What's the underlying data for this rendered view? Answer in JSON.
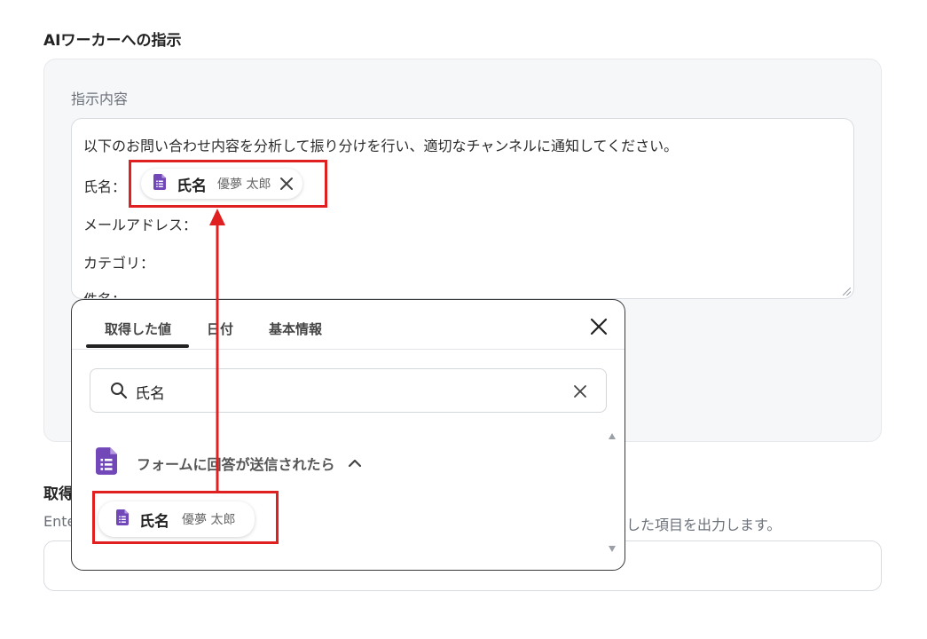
{
  "section_title": "AIワーカーへの指示",
  "instruction": {
    "label": "指示内容",
    "lines": [
      "以下のお問い合わせ内容を分析して振り分けを行い、適切なチャンネルに通知してください。",
      "氏名：",
      "メールアドレス：",
      "カテゴリ：",
      "件名："
    ],
    "chip": {
      "name": "氏名",
      "value": "優夢 太郎",
      "icon": "google-forms-icon"
    }
  },
  "popup": {
    "tabs": [
      "取得した値",
      "日付",
      "基本情報"
    ],
    "active_tab": "取得した値",
    "search_value": "氏名",
    "group_label": "フォームに回答が送信されたら",
    "group_icon": "google-forms-icon",
    "result_chip": {
      "name": "氏名",
      "value": "優夢 太郎"
    }
  },
  "below": {
    "title": "取得",
    "desc_left": "Ente",
    "desc_right": "した項目を出力します。"
  },
  "colors": {
    "highlight": "#e02020",
    "forms_purple": "#7248b9",
    "panel_bg": "#f6f7f9"
  }
}
